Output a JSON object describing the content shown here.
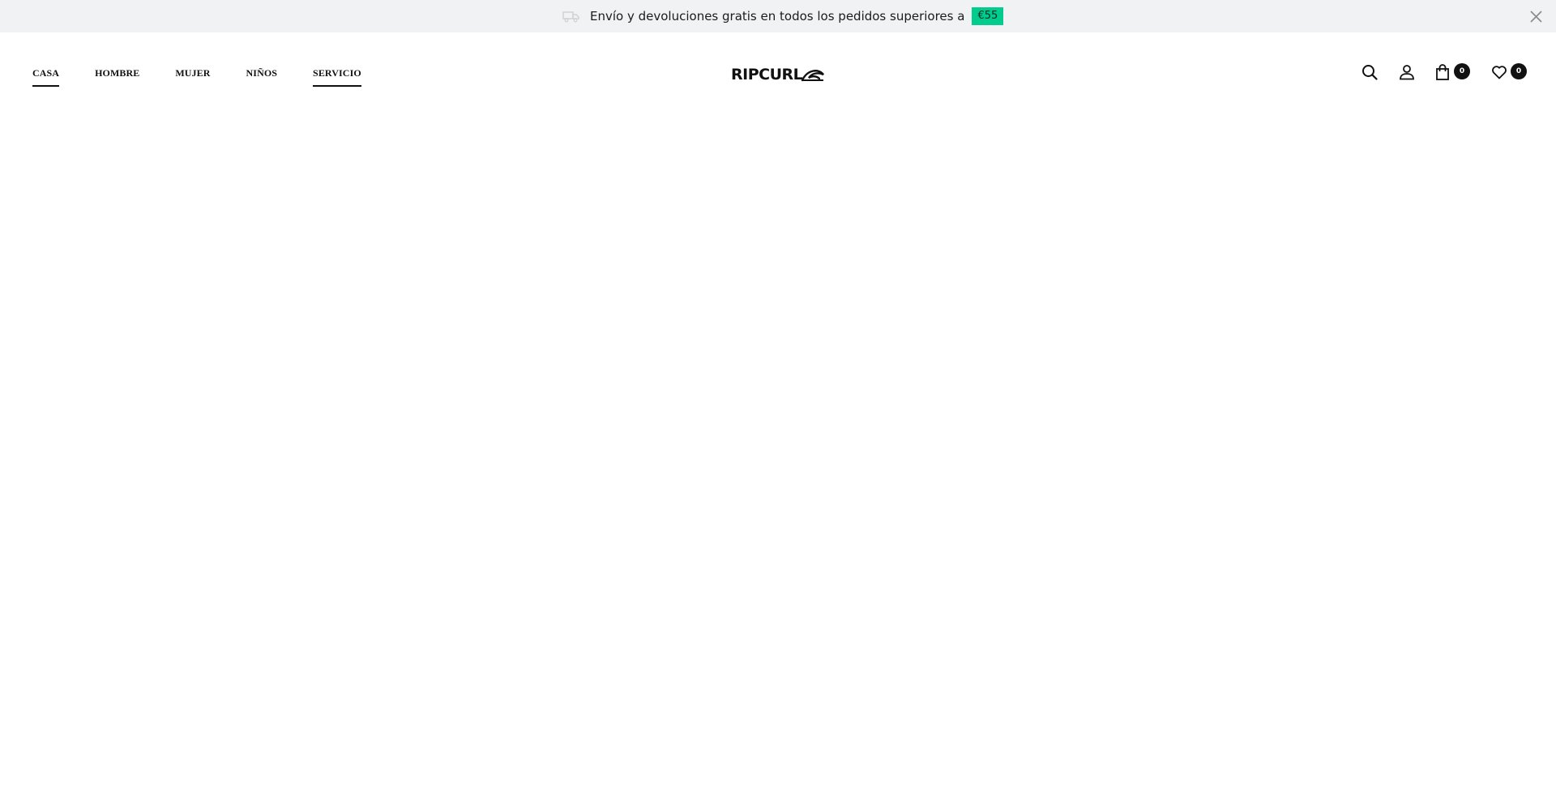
{
  "announcement": {
    "text": "Envío y devoluciones gratis en todos los pedidos superiores a",
    "badge": "€55",
    "badge_color": "#00cc8e",
    "icon": "truck-icon",
    "close_icon": "close-icon"
  },
  "nav": {
    "items": [
      {
        "label": "CASA"
      },
      {
        "label": "HOMBRE"
      },
      {
        "label": "MUJER"
      },
      {
        "label": "NIÑOS"
      },
      {
        "label": "SERVICIO"
      }
    ]
  },
  "brand": {
    "logo_text": "RIPCURL"
  },
  "header_icons": {
    "search": "search-icon",
    "account": "user-icon",
    "cart": "shopping-bag-icon",
    "cart_count": "0",
    "wishlist": "heart-icon",
    "wishlist_count": "0"
  }
}
